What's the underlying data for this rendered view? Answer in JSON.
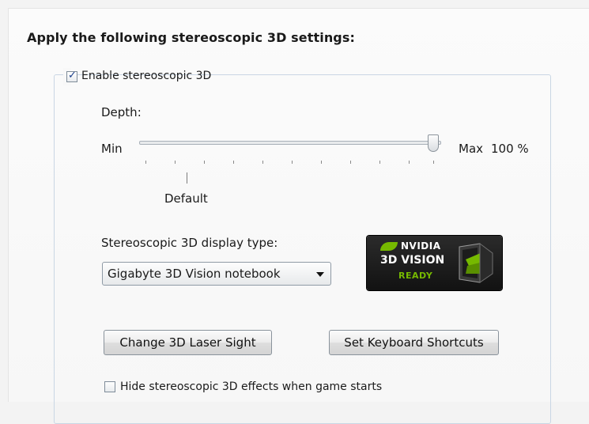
{
  "heading": "Apply the following stereoscopic 3D settings:",
  "enable": {
    "label": "Enable stereoscopic 3D",
    "checked": true
  },
  "depth": {
    "label": "Depth:",
    "min_label": "Min",
    "max_label": "Max",
    "value_text": "100 %",
    "value": 100,
    "default_label": "Default"
  },
  "display_type": {
    "label": "Stereoscopic 3D display type:",
    "selected": "Gigabyte 3D Vision notebook"
  },
  "badge": {
    "brand": "NVIDIA",
    "product": "3D VISION",
    "status": "READY",
    "brand_color": "#76b900"
  },
  "buttons": {
    "laser_sight": "Change 3D Laser Sight",
    "keyboard_shortcuts": "Set Keyboard Shortcuts"
  },
  "hide_effects": {
    "label": "Hide stereoscopic 3D effects when game starts",
    "checked": false
  }
}
